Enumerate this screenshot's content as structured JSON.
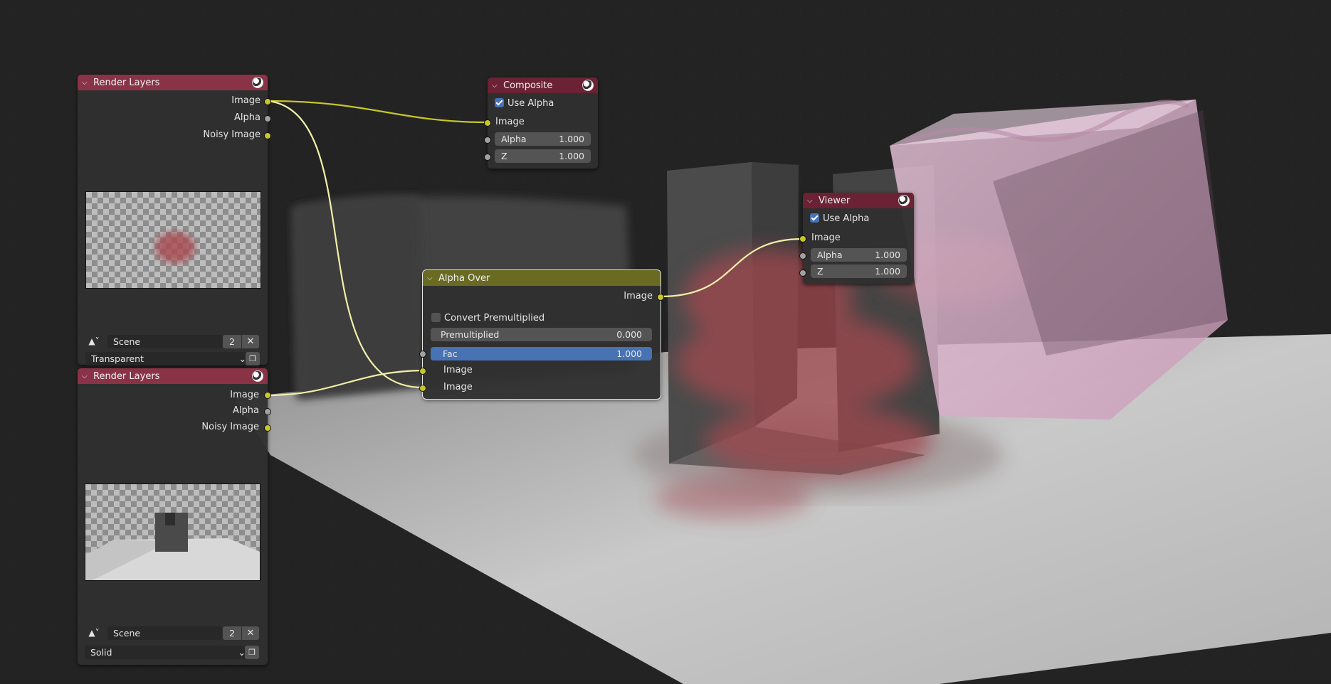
{
  "nodes": {
    "render_layers_1": {
      "title": "Render Layers",
      "outputs": [
        "Image",
        "Alpha",
        "Noisy Image"
      ],
      "scene": "Scene",
      "scene_users": "2",
      "close": "✕",
      "layer_mode": "Transparent"
    },
    "render_layers_2": {
      "title": "Render Layers",
      "outputs": [
        "Image",
        "Alpha",
        "Noisy Image"
      ],
      "scene": "Scene",
      "scene_users": "2",
      "close": "✕",
      "layer_mode": "Solid"
    },
    "composite": {
      "title": "Composite",
      "use_alpha_label": "Use Alpha",
      "input_image": "Image",
      "alpha_label": "Alpha",
      "alpha_value": "1.000",
      "z_label": "Z",
      "z_value": "1.000"
    },
    "viewer": {
      "title": "Viewer",
      "use_alpha_label": "Use Alpha",
      "input_image": "Image",
      "alpha_label": "Alpha",
      "alpha_value": "1.000",
      "z_label": "Z",
      "z_value": "1.000"
    },
    "alpha_over": {
      "title": "Alpha Over",
      "output_image": "Image",
      "convert_premultiplied": "Convert Premultiplied",
      "premultiplied_label": "Premultiplied",
      "premultiplied_value": "0.000",
      "fac_label": "Fac",
      "fac_value": "1.000",
      "input_image_1": "Image",
      "input_image_2": "Image"
    }
  },
  "colors": {
    "socket_image": "#c7c729",
    "socket_value": "#a1a1a1",
    "render_header": "#8a3347",
    "output_header": "#6b2234",
    "mix_header": "#6a6a22",
    "accent": "#4772b3"
  }
}
